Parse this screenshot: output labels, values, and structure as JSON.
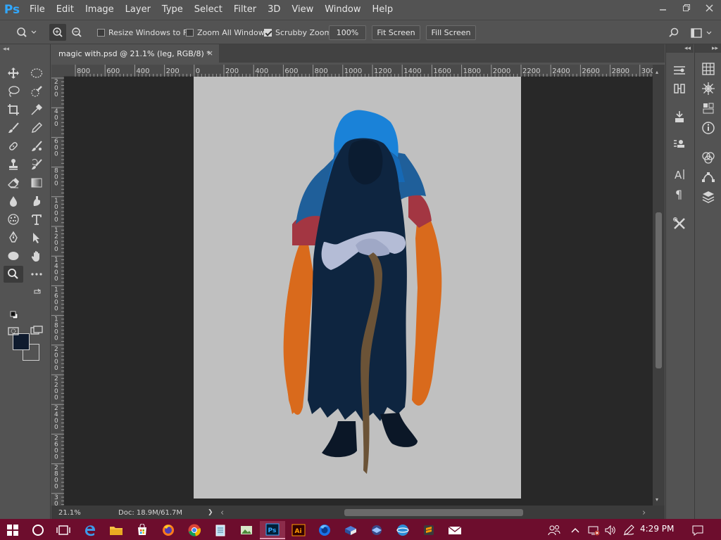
{
  "app": {
    "logo": "Ps"
  },
  "menu": [
    "File",
    "Edit",
    "Image",
    "Layer",
    "Type",
    "Select",
    "Filter",
    "3D",
    "View",
    "Window",
    "Help"
  ],
  "window_controls": {
    "minimize": "minimize-icon",
    "restore": "restore-icon",
    "close": "close-icon"
  },
  "options": {
    "tool_icon": "zoom-icon",
    "zoom_in_icon": "zoom-in-icon",
    "zoom_out_icon": "zoom-out-icon",
    "resize_windows": {
      "label": "Resize Windows to Fit",
      "checked": false
    },
    "zoom_all": {
      "label": "Zoom All Windows",
      "checked": false
    },
    "scrubby": {
      "label": "Scrubby Zoom",
      "checked": true
    },
    "percent_button": "100%",
    "fit_screen": "Fit Screen",
    "fill_screen": "Fill Screen"
  },
  "document": {
    "tab_title": "magic with.psd @ 21.1% (leg, RGB/8) *",
    "close": "×"
  },
  "ruler": {
    "h_labels": [
      "800",
      "600",
      "400",
      "200",
      "0",
      "200",
      "400",
      "600",
      "800",
      "1000",
      "1200",
      "1400",
      "1600",
      "1800",
      "2000",
      "2200",
      "2400",
      "2600",
      "2800",
      "300"
    ],
    "v_labels": [
      "2\n0\n0",
      "4\n0\n0",
      "6\n0\n0",
      "8\n0\n0",
      "1\n0\n0\n0",
      "1\n2\n0\n0",
      "1\n4\n0\n0",
      "1\n6\n0\n0",
      "1\n8\n0\n0",
      "2\n0\n0\n0",
      "2\n2\n0\n0",
      "2\n4\n0\n0",
      "2\n6\n0\n0",
      "2\n8\n0\n0",
      "3\n0\n0\n0",
      "3"
    ]
  },
  "status": {
    "zoom": "21.1%",
    "doc": "Doc: 18.9M/61.7M",
    "arrow": "❯",
    "scroll_left": "‹",
    "scroll_right": "›"
  },
  "colors": {
    "foreground": "#0f1b2e",
    "background": "#535353",
    "canvas_bg": "#c0c0c0",
    "taskbar": "#6d0d2d",
    "hood_blue": "#1a82d8",
    "cloak_navy": "#0e2540",
    "fur_orange": "#d96a1c",
    "fur_red": "#a33642",
    "staff_brown": "#6b5337",
    "hands": "#b4bcd6"
  },
  "panels": {
    "col1": [
      "brush-settings-icon",
      "clone-source-icon",
      "actions-icon",
      "tool-presets-icon",
      "character-icon",
      "paragraph-icon",
      "properties-tool-icon"
    ],
    "col2": [
      "grid-icon",
      "navigator-icon",
      "libraries-icon",
      "info-icon",
      "channels-icon",
      "paths-icon",
      "layers-icon"
    ]
  },
  "taskbar": {
    "time": "4:29 PM",
    "icons": [
      "windows-start-icon",
      "cortana-icon",
      "task-view-icon",
      "edge-icon",
      "file-explorer-icon",
      "store-icon",
      "firefox-icon",
      "chrome-icon",
      "notepad-icon",
      "image-viewer-icon",
      "photoshop-icon",
      "illustrator-icon",
      "firefox-dev-icon",
      "app-icon",
      "app2-icon",
      "app3-icon",
      "sublime-icon",
      "mail-icon"
    ],
    "tray": [
      "people-icon",
      "tray-up-icon",
      "network-icon",
      "volume-icon",
      "pen-icon",
      "notifications-icon"
    ]
  }
}
